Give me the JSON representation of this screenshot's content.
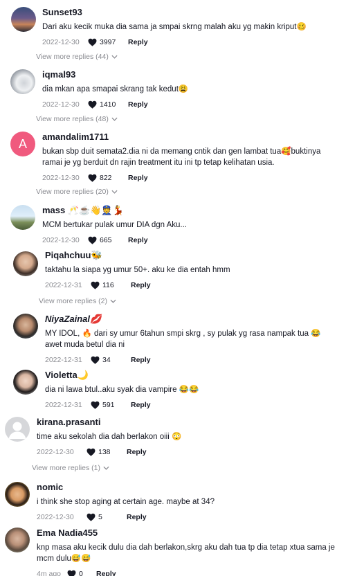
{
  "labels": {
    "reply": "Reply"
  },
  "comments": [
    {
      "username": "Sunset93",
      "text": "Dari aku kecik muka dia sama ja smpai skrng malah aku yg makin kriput🥴",
      "date": "2022-12-30",
      "likes": "3997",
      "view_more": "View more replies (44)",
      "avatar_icon": "sunset-photo"
    },
    {
      "username": "iqmal93",
      "text": "dia mkan apa smapai skrang tak kedut😩",
      "date": "2022-12-30",
      "likes": "1410",
      "view_more": "View more replies (48)",
      "avatar_icon": "car-photo"
    },
    {
      "username": "amandalim1711",
      "avatar_letter": "A",
      "text": "bukan sbp duit semata2.dia ni da memang cntik dan gen lambat tua🥰buktinya ramai je yg berduit dn rajin treatment itu ini tp tetap kelihatan usia.",
      "date": "2022-12-30",
      "likes": "822",
      "view_more": "View more replies (20)",
      "avatar_icon": "letter-avatar"
    },
    {
      "username": "mass 🥂☕👋👮💃",
      "text": "MCM bertukar pulak umur DIA dgn Aku...",
      "date": "2022-12-30",
      "likes": "665",
      "avatar_icon": "landscape-photo"
    },
    {
      "username": "Piqahchuu🐝",
      "text": "taktahu la siapa yg umur 50+. aku ke dia entah hmm",
      "date": "2022-12-31",
      "likes": "116",
      "view_more": "View more replies (2)",
      "avatar_icon": "person-photo"
    },
    {
      "username": "NiyaZainal💋",
      "text": "MY IDOL, 🔥 dari sy umur 6tahun smpi skrg , sy pulak yg rasa nampak tua 😂 awet muda betul dia ni",
      "date": "2022-12-31",
      "likes": "34",
      "avatar_icon": "person-photo"
    },
    {
      "username": "Violetta🌙",
      "text": "dia ni lawa btul..aku syak dia vampire 😂😂",
      "date": "2022-12-31",
      "likes": "591",
      "avatar_icon": "person-photo"
    },
    {
      "username": "kirana.prasanti",
      "text": "time aku sekolah dia dah berlakon oiii 😳",
      "date": "2022-12-30",
      "likes": "138",
      "view_more": "View more replies (1)",
      "avatar_icon": "default-user-icon"
    },
    {
      "username": "nomic",
      "text": "i think she stop aging at certain age. maybe at 34?",
      "date": "2022-12-30",
      "likes": "5",
      "avatar_icon": "person-photo"
    },
    {
      "username": "Ema Nadia455",
      "text": "knp masa aku kecik dulu dia dah berlakon,skrg aku dah tua tp dia tetap xtua sama je mcm dulu😅😅",
      "date": "4m ago",
      "likes": "0",
      "avatar_icon": "person-photo"
    }
  ]
}
